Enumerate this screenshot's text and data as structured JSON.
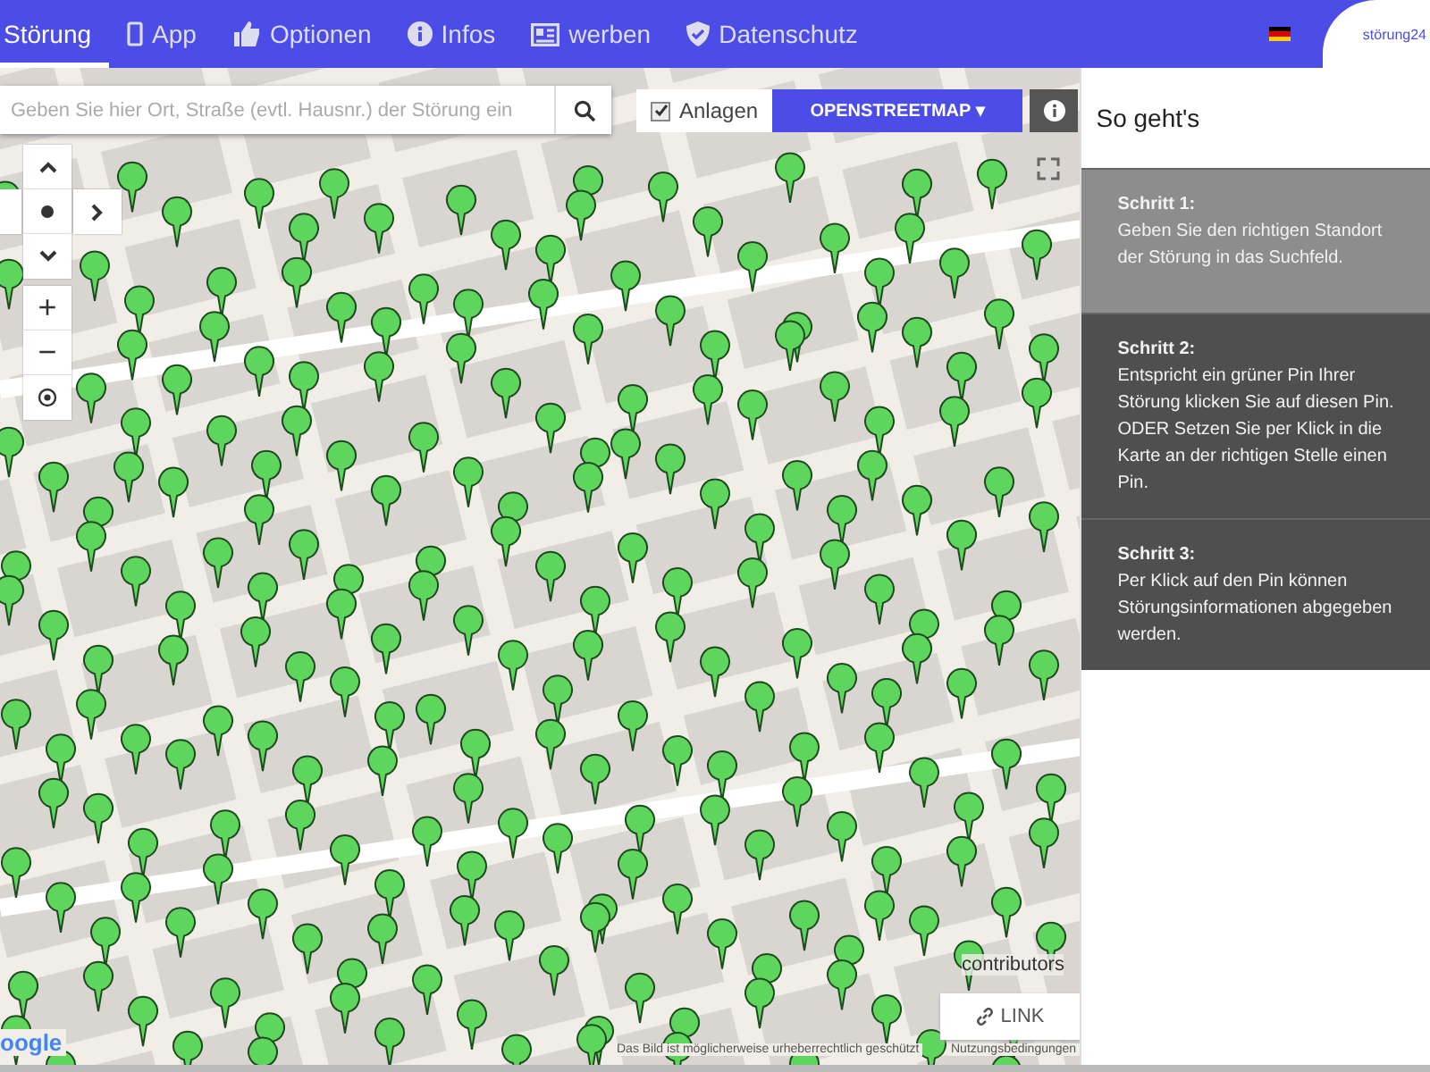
{
  "nav": {
    "items": [
      {
        "label": "Störung",
        "kind": "plain",
        "selected": true
      },
      {
        "label": "App",
        "kind": "phone",
        "selected": false
      },
      {
        "label": "Optionen",
        "kind": "hand",
        "selected": false
      },
      {
        "label": "Infos",
        "kind": "info",
        "selected": false
      },
      {
        "label": "werben",
        "kind": "ad",
        "selected": false
      },
      {
        "label": "Datenschutz",
        "kind": "shield",
        "selected": false
      }
    ],
    "logo": "störung24"
  },
  "map": {
    "search": {
      "placeholder": "Geben Sie hier Ort, Straße (evtl. Hausnr.) der Störung ein"
    },
    "layers": {
      "label": "Anlagen",
      "checked": true
    },
    "map_type": "OPENSTREETMAP ▾",
    "zoom_in": "+",
    "zoom_out": "−",
    "attribution": "contributors",
    "link_button": "LINK",
    "google": "oogle",
    "footer_note": "Das Bild ist möglicherweise urheberrechtlich geschützt",
    "terms": "Nutzungsbedingungen"
  },
  "help": {
    "title": "So geht's",
    "steps": [
      {
        "title": "Schritt 1:",
        "text": "Geben Sie den richtigen Standort der Störung in das Suchfeld.",
        "selected": true
      },
      {
        "title": "Schritt 2:",
        "text": "Entspricht ein grüner Pin Ihrer Störung klicken Sie auf diesen Pin. ODER Setzen Sie per Klick in die Karte an der richtigen Stelle einen Pin.",
        "selected": false
      },
      {
        "title": "Schritt 3:",
        "text": "Per Klick auf den Pin können Störungsinformationen abgegeben werden.",
        "selected": false
      }
    ]
  }
}
